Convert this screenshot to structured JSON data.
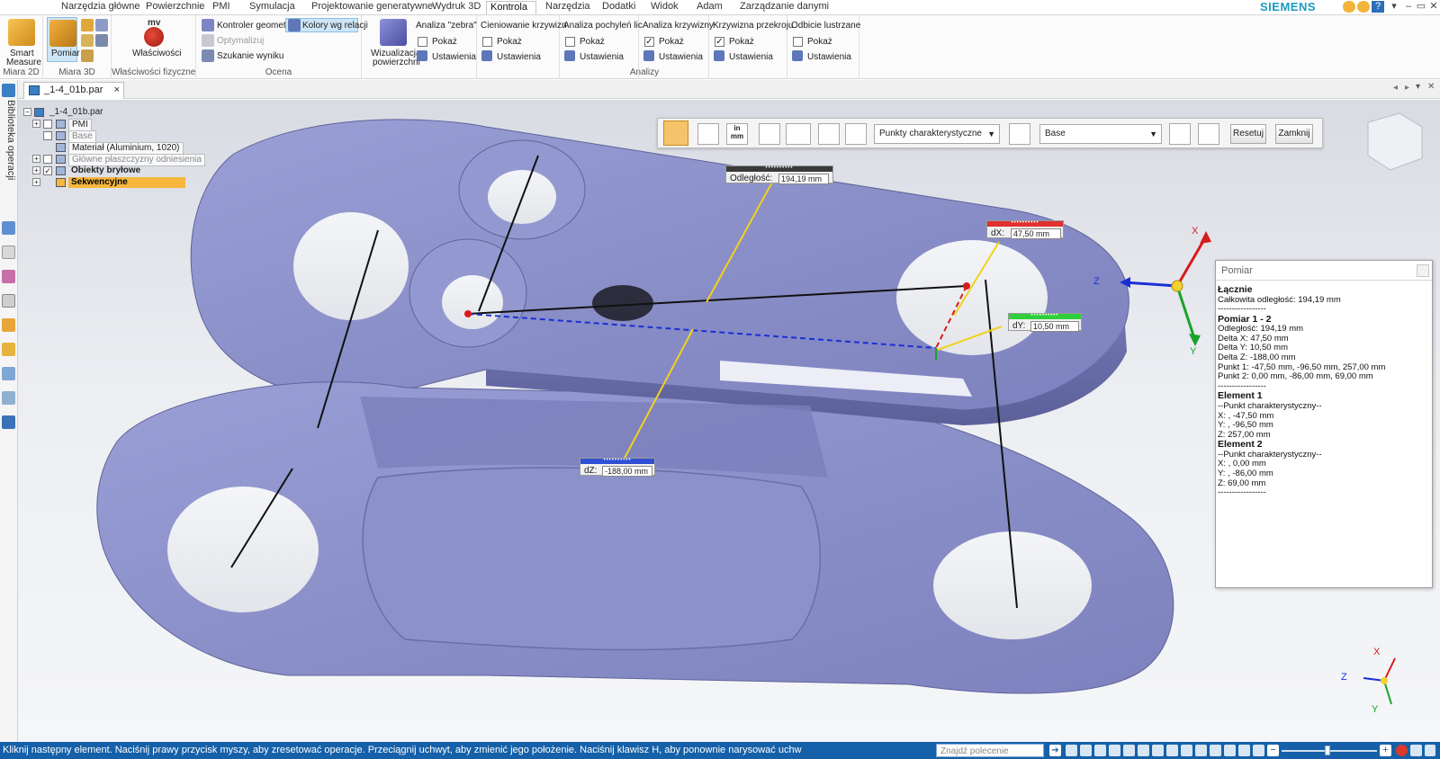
{
  "ribbon": {
    "tabs": [
      "Narzędzia główne",
      "Powierzchnie",
      "PMI",
      "Symulacja",
      "Projektowanie generatywne",
      "Wydruk 3D",
      "Kontrola",
      "Narzędzia",
      "Dodatki",
      "Widok",
      "Adam",
      "Zarządzanie danymi"
    ],
    "active_tab": "Kontrola",
    "brand": "SIEMENS",
    "groups": {
      "miara2d": {
        "label": "Miara 2D",
        "smart_measure_line1": "Smart",
        "smart_measure_line2": "Measure"
      },
      "miara3d": {
        "label": "Miara 3D",
        "pomiar": "Pomiar"
      },
      "wlasciwosci": {
        "label": "Właściwości fizyczne",
        "btn": "Właściwości",
        "icon_text": "mv"
      },
      "ocena": {
        "label": "Ocena",
        "kontroler": "Kontroler geometrii",
        "kolory": "Kolory wg relacji",
        "optymalizuj": "Optymalizuj",
        "szukanie": "Szukanie wyniku"
      },
      "analizy": {
        "label": "Analizy",
        "wizualizacja_line1": "Wizualizacja",
        "wizualizacja_line2": "powierzchni",
        "columns": [
          {
            "title": "Analiza \"zebra\"",
            "show": "Pokaż",
            "settings": "Ustawienia",
            "checked": false
          },
          {
            "title": "Cieniowanie krzywizn",
            "show": "Pokaż",
            "settings": "Ustawienia",
            "checked": false
          },
          {
            "title": "Analiza pochyleń lic",
            "show": "Pokaż",
            "settings": "Ustawienia",
            "checked": false
          },
          {
            "title": "Analiza krzywizny",
            "show": "Pokaż",
            "settings": "Ustawienia",
            "checked": true
          },
          {
            "title": "Krzywizna przekroju",
            "show": "Pokaż",
            "settings": "Ustawienia",
            "checked": true
          },
          {
            "title": "Odbicie lustrzane",
            "show": "Pokaż",
            "settings": "Ustawienia",
            "checked": false
          }
        ]
      }
    }
  },
  "document": {
    "tab_name": "_1-4_01b.par",
    "close": "×"
  },
  "left_panel": {
    "title": "Biblioteka operacji"
  },
  "tree": {
    "root": "_1-4_01b.par",
    "items": [
      {
        "label": "PMI",
        "style": "boxed"
      },
      {
        "label": "Base",
        "style": "boxed-dim"
      },
      {
        "label": "Materiał (Aluminium, 1020)",
        "style": "boxed"
      },
      {
        "label": "Główne płaszczyzny odniesienia",
        "style": "boxed-dim"
      },
      {
        "label": "Obiekty bryłowe",
        "style": "bold"
      },
      {
        "label": "Sekwencyjne",
        "style": "selected"
      }
    ]
  },
  "measure_toolbar": {
    "mode_select": "Punkty charakterystyczne",
    "base_select": "Base",
    "reset": "Resetuj",
    "close": "Zamknij",
    "unit_icon_top": "in",
    "unit_icon_bottom": "mm"
  },
  "labels": {
    "distance": {
      "caption": "Odległość:",
      "value": "194,19 mm"
    },
    "dx": {
      "caption": "dX:",
      "value": "47,50 mm"
    },
    "dy": {
      "caption": "dY:",
      "value": "10,50 mm"
    },
    "dz": {
      "caption": "dZ:",
      "value": "-188,00 mm"
    },
    "bar_dots": "••••••••••"
  },
  "axes": {
    "x": "X",
    "y": "Y",
    "z": "Z"
  },
  "pomiar_panel": {
    "title": "Pomiar",
    "lines": [
      {
        "t": "Łącznie",
        "b": true
      },
      {
        "t": "Całkowita odległość: 194,19 mm",
        "b": false
      },
      {
        "t": "-----------------",
        "b": false
      },
      {
        "t": "Pomiar 1 - 2",
        "b": true
      },
      {
        "t": "Odległość:  194,19 mm",
        "b": false
      },
      {
        "t": "Delta X:  47,50 mm",
        "b": false
      },
      {
        "t": "Delta Y:  10,50 mm",
        "b": false
      },
      {
        "t": "Delta Z:  -188,00 mm",
        "b": false
      },
      {
        "t": "Punkt 1:  -47,50 mm, -96,50 mm, 257,00 mm",
        "b": false
      },
      {
        "t": "Punkt 2:  0,00 mm, -86,00 mm, 69,00 mm",
        "b": false
      },
      {
        "t": "-----------------",
        "b": false
      },
      {
        "t": "Element 1",
        "b": true
      },
      {
        "t": "--Punkt charakterystyczny--",
        "b": false
      },
      {
        "t": "X: , -47,50 mm",
        "b": false
      },
      {
        "t": "Y: , -96,50 mm",
        "b": false
      },
      {
        "t": "Z:  257,00 mm",
        "b": false
      },
      {
        "t": "Element 2",
        "b": true
      },
      {
        "t": "--Punkt charakterystyczny--",
        "b": false
      },
      {
        "t": "X: , 0,00 mm",
        "b": false
      },
      {
        "t": "Y: , -86,00 mm",
        "b": false
      },
      {
        "t": "Z:  69,00 mm",
        "b": false
      },
      {
        "t": "-----------------",
        "b": false
      }
    ]
  },
  "status": {
    "message": "Kliknij następny element. Naciśnij prawy przycisk myszy, aby zresetować operacje. Przeciągnij uchwyt, aby zmienić jego położenie. Naciśnij klawisz H, aby ponownie narysować uchw",
    "search_placeholder": "Znajdź polecenie"
  },
  "colors": {
    "part": "#8a8fc4",
    "accent": "#1560a8",
    "active_tool": "#f5c46a"
  }
}
